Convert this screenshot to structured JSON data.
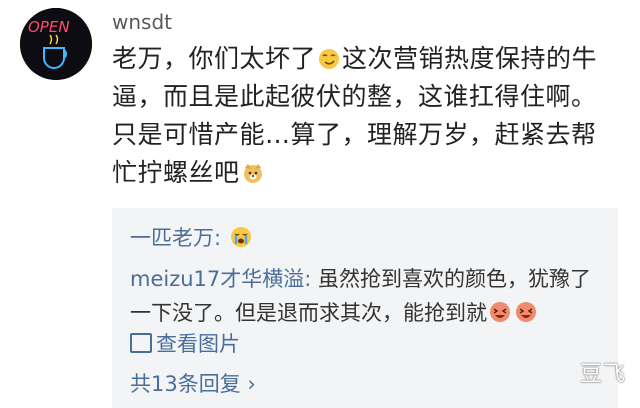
{
  "post": {
    "username": "wnsdt",
    "avatar_sign": "OPEN",
    "comment_lines": [
      "老万，你们太坏了",
      "这次营销热度保持的牛",
      "逼，而且是此起彼伏的整，这谁扛得住啊。",
      "只是可惜产能…算了，理解万岁，赶紧去帮",
      "忙拧螺丝吧"
    ]
  },
  "replies": {
    "reply1_author": "一匹老万:",
    "reply2_author": "meizu17才华横溢:",
    "reply2_text": " 虽然抢到喜欢的颜色，犹豫了一下没了。但是退而求其次，能抢到就",
    "view_images": "查看图片",
    "more_replies": "共13条回复 ›"
  },
  "watermark": "豆飞",
  "colors": {
    "link": "#4a6e9a",
    "reply_bg": "#f3f4f6",
    "text": "#222222"
  },
  "icons": [
    "smirk-emoji",
    "dog-emoji",
    "crying-emoji",
    "laughing-emoji",
    "image-icon"
  ]
}
